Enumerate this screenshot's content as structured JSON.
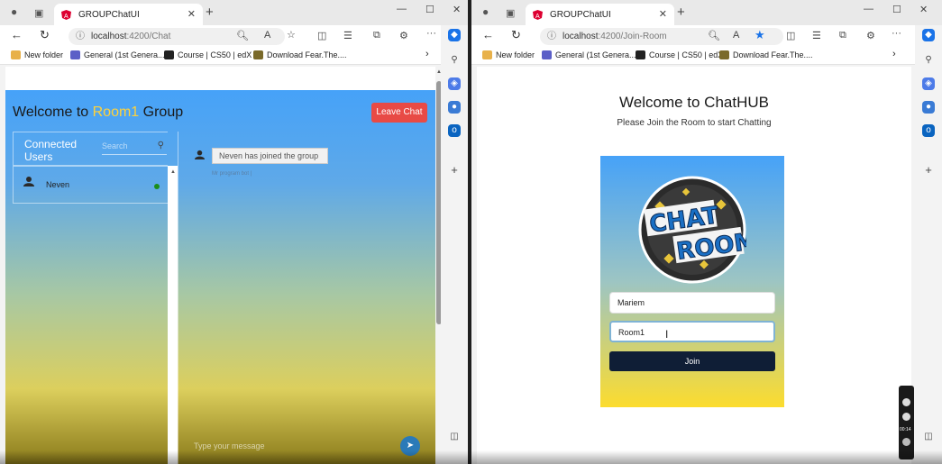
{
  "left": {
    "tab_title": "GROUPChatUI",
    "address_host": "localhost",
    "address_path": ":4200/Chat",
    "favorites": [
      "New folder",
      "General (1st Genera...",
      "Course | CS50 | edX",
      "Download Fear.The...."
    ],
    "header": {
      "prefix": "Welcome to ",
      "room": "Room1",
      "suffix": " Group"
    },
    "leave_label": "Leave Chat",
    "users_title": "Connected Users",
    "search_placeholder": "Search",
    "users": [
      {
        "name": "Neven",
        "status_color": "#1b8e1b"
      }
    ],
    "messages": [
      {
        "text": "Neven has joined the group",
        "meta": "Mr program bot |"
      }
    ],
    "type_placeholder": "Type your message"
  },
  "right": {
    "tab_title": "GROUPChatUI",
    "address_host": "localhost",
    "address_path": ":4200/Join-Room",
    "favorites": [
      "New folder",
      "General (1st Genera...",
      "Course | CS50 | edX",
      "Download Fear.The...."
    ],
    "title": "Welcome to ChatHUB",
    "subtitle": "Please Join the Room to start Chatting",
    "logo_top": "CHAT",
    "logo_bottom": "ROOM",
    "name_value": "Mariem",
    "room_value": "Room1",
    "join_label": "Join"
  },
  "recorder_time": "00:14",
  "colors": {
    "accent": "#46a2f8",
    "leave": "#e84a45",
    "join": "#0f1e36",
    "room_highlight": "#ffd23a"
  }
}
